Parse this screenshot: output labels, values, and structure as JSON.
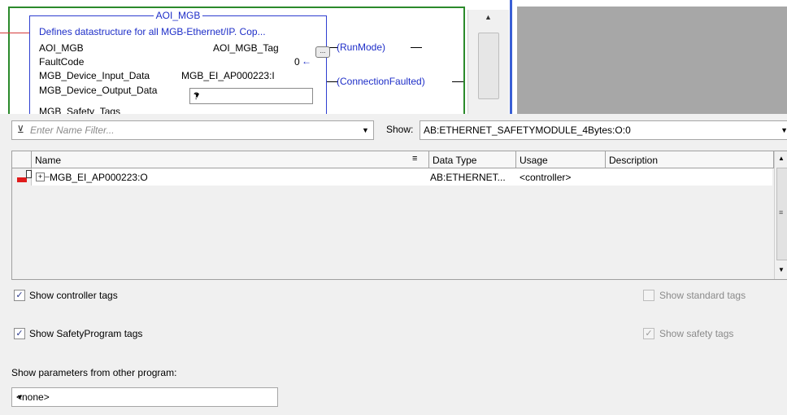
{
  "aoi": {
    "title": "AOI_MGB",
    "description": "Defines datastructure for all MGB-Ethernet/IP. Cop...",
    "rows": [
      {
        "label": "AOI_MGB",
        "value": "AOI_MGB_Tag"
      },
      {
        "label": "FaultCode",
        "value": "0"
      },
      {
        "label": "MGB_Device_Input_Data",
        "value": "MGB_EI_AP000223:I"
      },
      {
        "label": "MGB_Device_Output_Data",
        "value": "?"
      },
      {
        "label": "MGB_Safety_Tags"
      }
    ],
    "ellipsis_label": "...",
    "arrow_glyph": "←",
    "coils": [
      "(RunMode)",
      "(ConnectionFaulted)"
    ]
  },
  "filter": {
    "placeholder": "Enter Name Filter...",
    "icon": "filter-icon"
  },
  "show": {
    "label": "Show:",
    "value": "AB:ETHERNET_SAFETYMODULE_4Bytes:O:0"
  },
  "grid": {
    "columns": [
      "Name",
      "Data Type",
      "Usage",
      "Description"
    ],
    "rows": [
      {
        "name": "MGB_EI_AP000223:O",
        "data_type": "AB:ETHERNET...",
        "usage": "<controller>",
        "description": ""
      }
    ],
    "expander_glyph": "+",
    "sort_glyph": "≡",
    "grip_glyph": "≡"
  },
  "options": {
    "show_controller_tags": {
      "label": "Show controller tags",
      "checked": true
    },
    "show_safety_program_tags": {
      "label": "Show SafetyProgram tags",
      "checked": true
    },
    "show_standard_tags": {
      "label": "Show standard tags",
      "checked": false
    },
    "show_safety_tags": {
      "label": "Show safety tags",
      "checked": true
    }
  },
  "params": {
    "label": "Show parameters from other program:",
    "value": "<none>"
  },
  "check_glyph": "✓",
  "colors": {
    "rung_green": "#2b8a2b",
    "aoi_blue": "#1e2ec8",
    "wire_red": "#d43a3a",
    "background_gray": "#a7a7a7"
  }
}
